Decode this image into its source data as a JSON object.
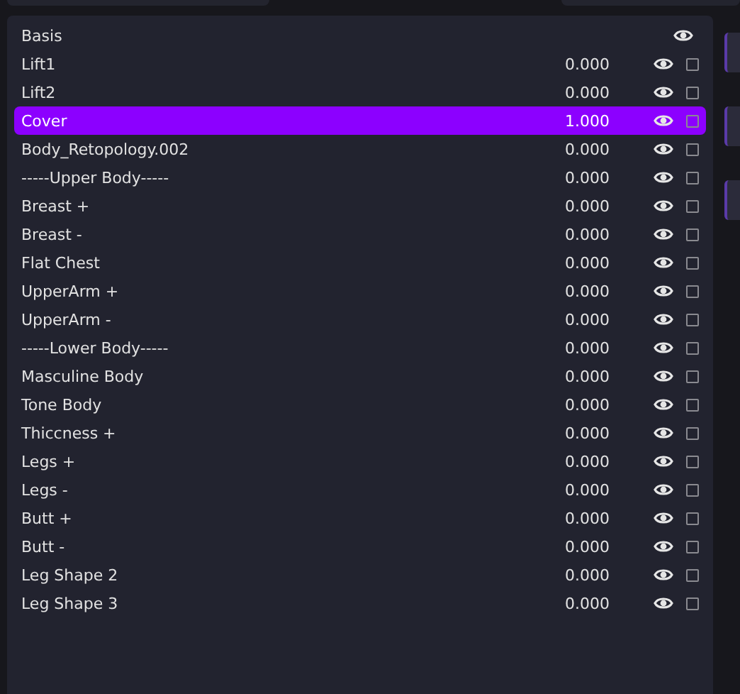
{
  "shape_keys": [
    {
      "kind": "basis",
      "name": "Basis",
      "selected": false
    },
    {
      "kind": "key",
      "name": "Lift1",
      "value": "0.000",
      "selected": false,
      "checked": false
    },
    {
      "kind": "key",
      "name": "Lift2",
      "value": "0.000",
      "selected": false,
      "checked": false
    },
    {
      "kind": "key",
      "name": "Cover",
      "value": "1.000",
      "selected": true,
      "checked": false
    },
    {
      "kind": "key",
      "name": "Body_Retopology.002",
      "value": "0.000",
      "selected": false,
      "checked": false
    },
    {
      "kind": "key",
      "name": "-----Upper Body-----",
      "value": "0.000",
      "selected": false,
      "checked": false
    },
    {
      "kind": "key",
      "name": "Breast +",
      "value": "0.000",
      "selected": false,
      "checked": false
    },
    {
      "kind": "key",
      "name": "Breast -",
      "value": "0.000",
      "selected": false,
      "checked": false
    },
    {
      "kind": "key",
      "name": "Flat Chest",
      "value": "0.000",
      "selected": false,
      "checked": false
    },
    {
      "kind": "key",
      "name": "UpperArm +",
      "value": "0.000",
      "selected": false,
      "checked": false
    },
    {
      "kind": "key",
      "name": "UpperArm -",
      "value": "0.000",
      "selected": false,
      "checked": false
    },
    {
      "kind": "key",
      "name": "-----Lower Body-----",
      "value": "0.000",
      "selected": false,
      "checked": false
    },
    {
      "kind": "key",
      "name": "Masculine Body",
      "value": "0.000",
      "selected": false,
      "checked": false
    },
    {
      "kind": "key",
      "name": "Tone Body",
      "value": "0.000",
      "selected": false,
      "checked": false
    },
    {
      "kind": "key",
      "name": "Thiccness +",
      "value": "0.000",
      "selected": false,
      "checked": false
    },
    {
      "kind": "key",
      "name": "Legs +",
      "value": "0.000",
      "selected": false,
      "checked": false
    },
    {
      "kind": "key",
      "name": "Legs -",
      "value": "0.000",
      "selected": false,
      "checked": false
    },
    {
      "kind": "key",
      "name": "Butt +",
      "value": "0.000",
      "selected": false,
      "checked": false
    },
    {
      "kind": "key",
      "name": "Butt -",
      "value": "0.000",
      "selected": false,
      "checked": false
    },
    {
      "kind": "key",
      "name": "Leg Shape 2",
      "value": "0.000",
      "selected": false,
      "checked": false
    },
    {
      "kind": "key",
      "name": "Leg Shape 3",
      "value": "0.000",
      "selected": false,
      "checked": false
    }
  ]
}
